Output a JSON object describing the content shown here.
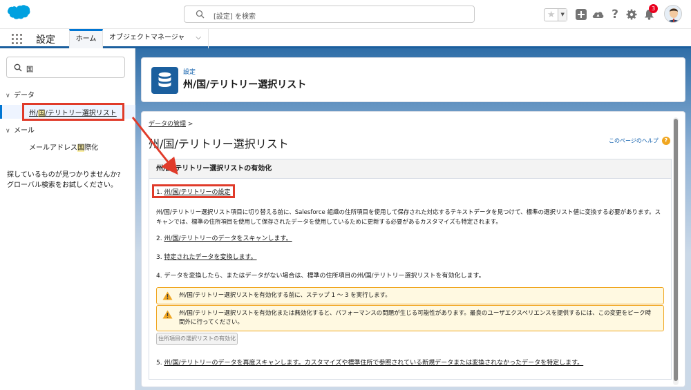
{
  "search": {
    "placeholder": "[設定] を検索"
  },
  "notifications": {
    "badge": "3"
  },
  "app": {
    "name": "設定",
    "tabs": [
      "ホーム",
      "オブジェクトマネージャ"
    ]
  },
  "sidebar": {
    "quickfind_value": "国",
    "groups": [
      {
        "label": "データ",
        "items": [
          {
            "pre": "州/",
            "hl": "国",
            "post": "/テリトリー選択リスト"
          }
        ]
      },
      {
        "label": "メール",
        "items": [
          {
            "pre": "メールアドレス",
            "hl": "国",
            "post": "際化"
          }
        ]
      }
    ],
    "help_line1": "探しているものが見つかりませんか?",
    "help_line2": "グローバル検索をお試しください。"
  },
  "header": {
    "section": "設定",
    "title": "州/国/テリトリー選択リスト"
  },
  "content": {
    "breadcrumb": "データの管理",
    "breadcrumb_sep": " >",
    "page_title": "州/国/テリトリー選択リスト",
    "help_link": "このページのヘルプ",
    "section_title": "州/国/テリトリー選択リストの有効化",
    "step1_num": "1. ",
    "step1_link": "州/国/テリトリーの設定",
    "description": "州/国/テリトリー選択リスト項目に切り替える前に、Salesforce 組織の住所項目を使用して保存された対応するテキストデータを見つけて、標準の選択リスト値に変換する必要があります。スキャンでは、標準の住所項目を使用して保存されたデータを使用しているために更新する必要があるカスタマイズも特定されます。",
    "step2_num": "2. ",
    "step2_link": "州/国/テリトリーのデータをスキャンします。",
    "step3_num": "3. ",
    "step3_link": "特定されたデータを変換します。",
    "step4": "4. データを変換したら、またはデータがない場合は、標準の住所項目の州/国/テリトリー選択リストを有効化します。",
    "warning1": "州/国/テリトリー選択リストを有効化する前に、ステップ 1 ～ 3 を実行します。",
    "warning2": "州/国/テリトリー選択リストを有効化または無効化すると、パフォーマンスの問題が生じる可能性があります。最良のユーザエクスペリエンスを提供するには、この変更をピーク時間外に行ってください。",
    "enable_button": "住所項目の選択リストの有効化",
    "step5_num": "5. ",
    "step5_link": "州/国/テリトリーのデータを再度スキャンします。カスタマイズや標準住所で参照されている新規データまたは変換されなかったデータを特定します。"
  },
  "colors": {
    "brand": "#0176d3",
    "header_blue": "#1b5f9e",
    "annotation_red": "#e03b2a",
    "warning_bg": "#fff9e1",
    "warning_border": "#f0a620"
  }
}
